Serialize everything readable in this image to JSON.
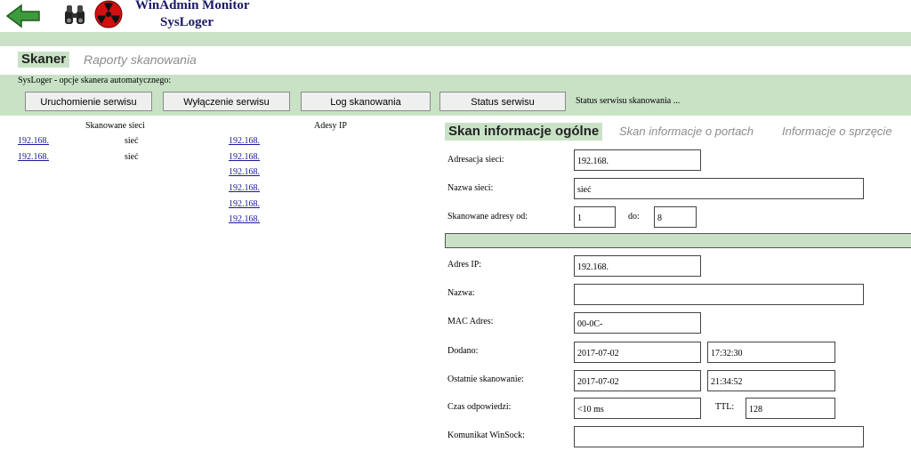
{
  "header": {
    "title": "WinAdmin Monitor",
    "subtitle": "SysLoger",
    "icons": [
      "back-arrow-icon",
      "binoculars-icon",
      "radiation-icon"
    ]
  },
  "tabs": {
    "active": "Skaner",
    "inactive": "Raporty skanowania"
  },
  "options": {
    "label": "SysLoger - opcje skanera automatycznego:",
    "buttons": {
      "start": "Uruchomienie serwisu",
      "stop": "Wyłączenie serwisu",
      "log": "Log skanowania",
      "status": "Status serwisu"
    },
    "status_text": "Status serwisu skanowania ..."
  },
  "networks": {
    "header": "Skanowane sieci",
    "rows": [
      {
        "address": "192.168.",
        "name": "sieć"
      },
      {
        "address": "192.168.",
        "name": "sieć"
      }
    ]
  },
  "ips": {
    "header": "Adesy IP",
    "items": [
      "192.168.",
      "192.168.",
      "192.168.",
      "192.168.",
      "192.168.",
      "192.168."
    ]
  },
  "detail_tabs": {
    "general": "Skan informacje ogólne",
    "ports": "Skan informacje o portach",
    "hardware": "Informacje o sprzęcie"
  },
  "form": {
    "network_address_label": "Adresacja sieci:",
    "network_address": "192.168.",
    "network_name_label": "Nazwa sieci:",
    "network_name": "sieć",
    "range_label": "Skanowane adresy od:",
    "range_from": "1",
    "range_to_label": "do:",
    "range_to": "8",
    "ip_label": "Adres IP:",
    "ip": "192.168.",
    "name_label": "Nazwa:",
    "name": "",
    "mac_label": "MAC Adres:",
    "mac": "00-0C-",
    "added_label": "Dodano:",
    "added_date": "2017-07-02",
    "added_time": "17:32:30",
    "last_scan_label": "Ostatnie skanowanie:",
    "last_scan_date": "2017-07-02",
    "last_scan_time": "21:34:52",
    "response_label": "Czas odpowiedzi:",
    "response": "<10 ms",
    "ttl_label": "TTL:",
    "ttl": "128",
    "winsock_label": "Komunikat WinSock:",
    "winsock": ""
  },
  "colors": {
    "band": "#c9e2c6",
    "title": "#1a1a66",
    "link": "#1a1a99"
  }
}
